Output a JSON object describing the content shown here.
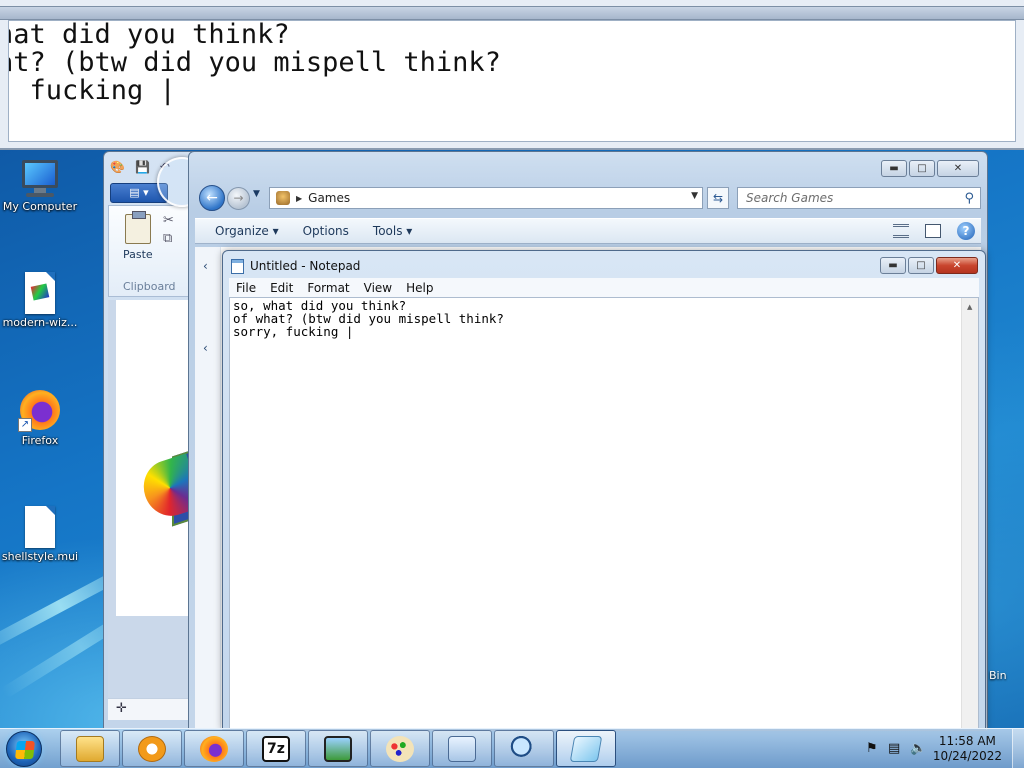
{
  "magnifier": {
    "lines": [
      "hat did you think?",
      "at? (btw did you mispell think?",
      "  fucking |"
    ]
  },
  "desktop": {
    "icons": [
      {
        "label": "My Computer",
        "icon": "computer-icon"
      },
      {
        "label": "modern-wiz...",
        "icon": "file-icon"
      },
      {
        "label": "Firefox",
        "icon": "firefox-icon"
      },
      {
        "label": "shellstyle.mui",
        "icon": "file-icon"
      }
    ],
    "partial_label": "Bin"
  },
  "paint": {
    "tab_label": "▤ ▾",
    "paste_label": "Paste",
    "clipboard_label": "Clipboard",
    "status_glyph": "✛"
  },
  "explorer": {
    "address": "Games",
    "search_placeholder": "Search Games",
    "commands": {
      "organize": "Organize ▾",
      "options": "Options",
      "tools": "Tools ▾"
    }
  },
  "notepad": {
    "title": "Untitled - Notepad",
    "menu": [
      "File",
      "Edit",
      "Format",
      "View",
      "Help"
    ],
    "content": "so, what did you think?\nof what? (btw did you mispell think?\nsorry, fucking |"
  },
  "taskbar": {
    "apps": [
      "folder-icon",
      "media-player-icon",
      "firefox-icon",
      "7zip-icon",
      "photo-viewer-icon",
      "paint-icon",
      "control-panel-icon",
      "magnifier-icon",
      "notepad-icon"
    ],
    "seven_zip_label": "7z",
    "clock": {
      "time": "11:58 AM",
      "date": "10/24/2022"
    }
  }
}
